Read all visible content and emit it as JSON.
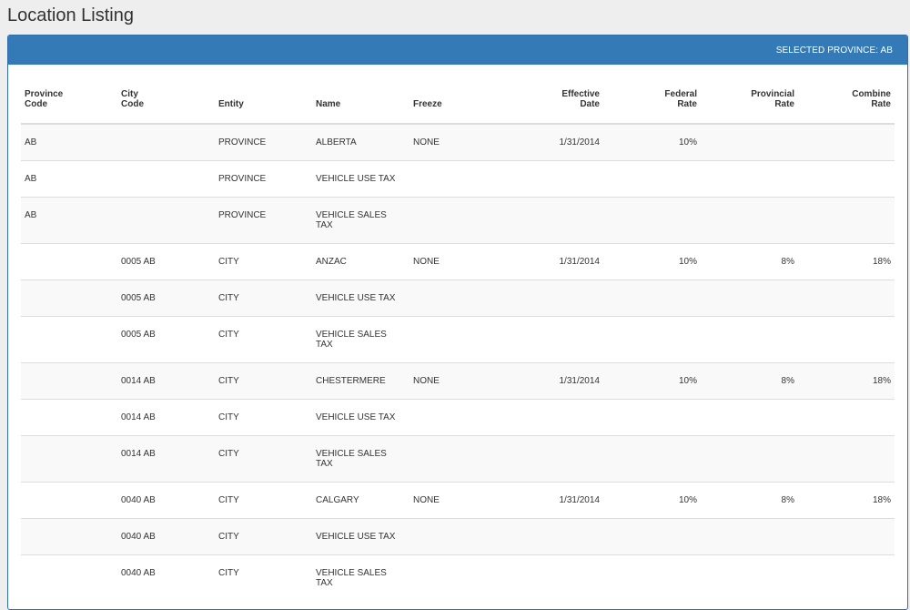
{
  "page": {
    "title": "Location Listing"
  },
  "panel": {
    "header": "SELECTED PROVINCE: AB"
  },
  "table": {
    "columns": [
      {
        "line1": "Province",
        "line2": "Code"
      },
      {
        "line1": "City",
        "line2": "Code"
      },
      {
        "line1": "",
        "line2": "Entity"
      },
      {
        "line1": "",
        "line2": "Name"
      },
      {
        "line1": "",
        "line2": "Freeze"
      },
      {
        "line1": "Effective",
        "line2": "Date"
      },
      {
        "line1": "Federal",
        "line2": "Rate"
      },
      {
        "line1": "Provincial",
        "line2": "Rate"
      },
      {
        "line1": "Combine",
        "line2": "Rate"
      }
    ],
    "rows": [
      {
        "province": "AB",
        "city": "",
        "entity": "PROVINCE",
        "name1": "ALBERTA",
        "name2": "",
        "freeze": "NONE",
        "date": "1/31/2014",
        "federal": "10%",
        "provincial": "",
        "combine": ""
      },
      {
        "province": "AB",
        "city": "",
        "entity": "PROVINCE",
        "name1": "VEHICLE USE TAX",
        "name2": "",
        "freeze": "",
        "date": "",
        "federal": "",
        "provincial": "",
        "combine": ""
      },
      {
        "province": "AB",
        "city": "",
        "entity": "PROVINCE",
        "name1": "VEHICLE SALES",
        "name2": "TAX",
        "freeze": "",
        "date": "",
        "federal": "",
        "provincial": "",
        "combine": ""
      },
      {
        "province": "",
        "city": "0005 AB",
        "entity": "CITY",
        "name1": "ANZAC",
        "name2": "",
        "freeze": "NONE",
        "date": "1/31/2014",
        "federal": "10%",
        "provincial": "8%",
        "combine": "18%"
      },
      {
        "province": "",
        "city": "0005 AB",
        "entity": "CITY",
        "name1": "VEHICLE USE TAX",
        "name2": "",
        "freeze": "",
        "date": "",
        "federal": "",
        "provincial": "",
        "combine": ""
      },
      {
        "province": "",
        "city": "0005 AB",
        "entity": "CITY",
        "name1": "VEHICLE SALES",
        "name2": "TAX",
        "freeze": "",
        "date": "",
        "federal": "",
        "provincial": "",
        "combine": ""
      },
      {
        "province": "",
        "city": "0014 AB",
        "entity": "CITY",
        "name1": "CHESTERMERE",
        "name2": "",
        "freeze": "NONE",
        "date": "1/31/2014",
        "federal": "10%",
        "provincial": "8%",
        "combine": "18%"
      },
      {
        "province": "",
        "city": "0014 AB",
        "entity": "CITY",
        "name1": "VEHICLE USE TAX",
        "name2": "",
        "freeze": "",
        "date": "",
        "federal": "",
        "provincial": "",
        "combine": ""
      },
      {
        "province": "",
        "city": "0014 AB",
        "entity": "CITY",
        "name1": "VEHICLE SALES",
        "name2": "TAX",
        "freeze": "",
        "date": "",
        "federal": "",
        "provincial": "",
        "combine": ""
      },
      {
        "province": "",
        "city": "0040 AB",
        "entity": "CITY",
        "name1": "CALGARY",
        "name2": "",
        "freeze": "NONE",
        "date": "1/31/2014",
        "federal": "10%",
        "provincial": "8%",
        "combine": "18%"
      },
      {
        "province": "",
        "city": "0040 AB",
        "entity": "CITY",
        "name1": "VEHICLE USE TAX",
        "name2": "",
        "freeze": "",
        "date": "",
        "federal": "",
        "provincial": "",
        "combine": ""
      },
      {
        "province": "",
        "city": "0040 AB",
        "entity": "CITY",
        "name1": "VEHICLE SALES",
        "name2": "TAX",
        "freeze": "",
        "date": "",
        "federal": "",
        "provincial": "",
        "combine": ""
      }
    ]
  }
}
